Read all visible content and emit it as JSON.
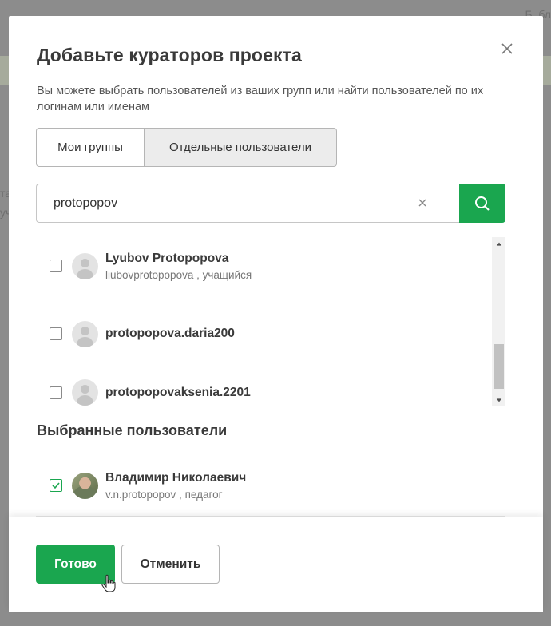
{
  "background": {
    "top_right_text": "Б..бл",
    "left_text_1": "та",
    "left_text_2": "уч"
  },
  "modal": {
    "title": "Добавьте кураторов проекта",
    "description": "Вы можете выбрать пользователей из ваших групп или найти пользователей по их логинам или именам",
    "close_icon": "close-icon"
  },
  "tabs": [
    {
      "label": "Мои группы",
      "active": false
    },
    {
      "label": "Отдельные пользователи",
      "active": true
    }
  ],
  "search": {
    "value": "protopopov",
    "placeholder": "",
    "button_icon": "search-icon"
  },
  "results": [
    {
      "name": "Lyubov Protopopova",
      "subtitle": "liubovprotopopova , учащийся",
      "checked": false
    },
    {
      "name": "protopopova.daria200",
      "subtitle": "",
      "checked": false
    },
    {
      "name": "protopopovaksenia.2201",
      "subtitle": "",
      "checked": false
    }
  ],
  "selected_section": {
    "title": "Выбранные пользователи",
    "items": [
      {
        "name": "Владимир Николаевич",
        "subtitle": "v.n.protopopov , педагог",
        "checked": true
      }
    ]
  },
  "footer": {
    "done_label": "Готово",
    "cancel_label": "Отменить"
  },
  "colors": {
    "accent": "#1aa64f",
    "overlay": "#8c8c8c"
  }
}
